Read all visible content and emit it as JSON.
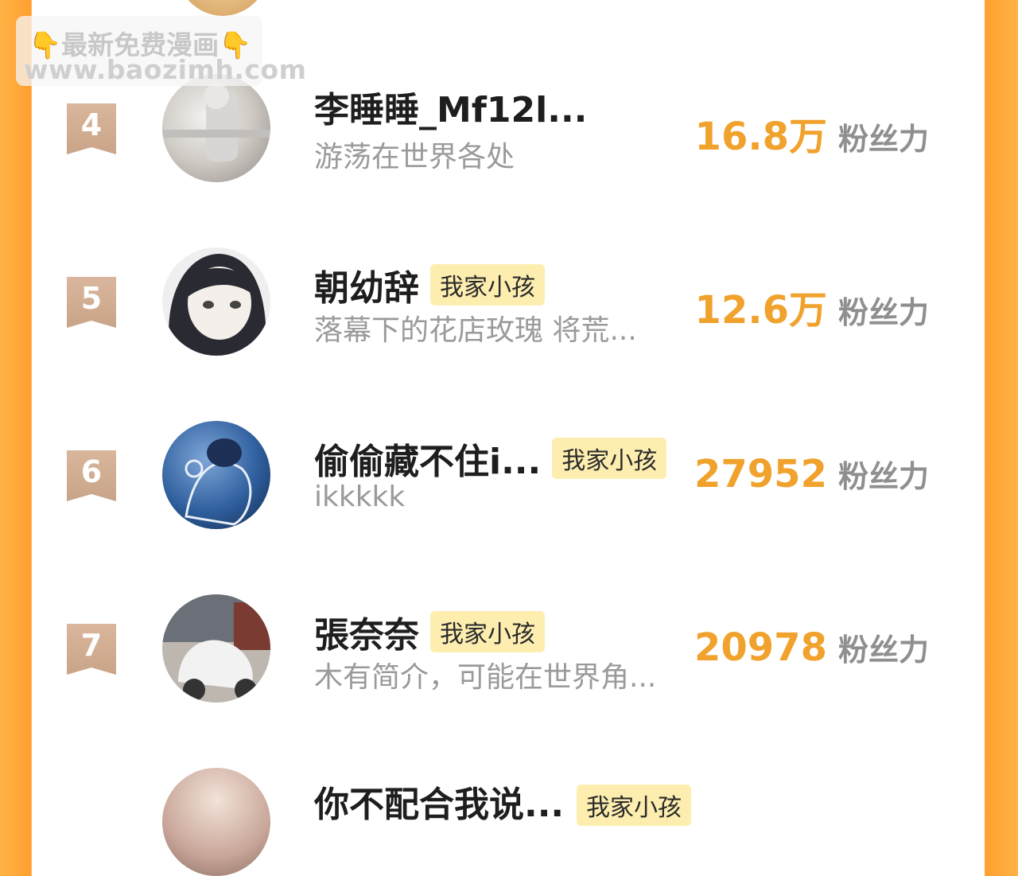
{
  "watermark": {
    "line1": "👇最新免费漫画👇",
    "line2": "www.baozimh.com"
  },
  "rankings": [
    {
      "rank": "4",
      "name": "李睡睡_Mf12l...",
      "tag": "",
      "bio": "游荡在世界各处",
      "fans": "16.8万",
      "fans_label": "粉丝力"
    },
    {
      "rank": "5",
      "name": "朝幼辞",
      "tag": "我家小孩",
      "bio": "落幕下的花店玫瑰 将荒...",
      "fans": "12.6万",
      "fans_label": "粉丝力"
    },
    {
      "rank": "6",
      "name": "偷偷藏不住i...",
      "tag": "我家小孩",
      "bio": "ikkkkk",
      "fans": "27952",
      "fans_label": "粉丝力"
    },
    {
      "rank": "7",
      "name": "張奈奈",
      "tag": "我家小孩",
      "bio": "木有简介，可能在世界角...",
      "fans": "20978",
      "fans_label": "粉丝力"
    }
  ],
  "partial_row": {
    "name": "你不配合我说...",
    "tag": "我家小孩"
  },
  "colors": {
    "accent": "#f0a22d",
    "tag_bg": "#fdeeb0",
    "rank_badge": "#d2ad92",
    "side": "#ff9f2e"
  }
}
